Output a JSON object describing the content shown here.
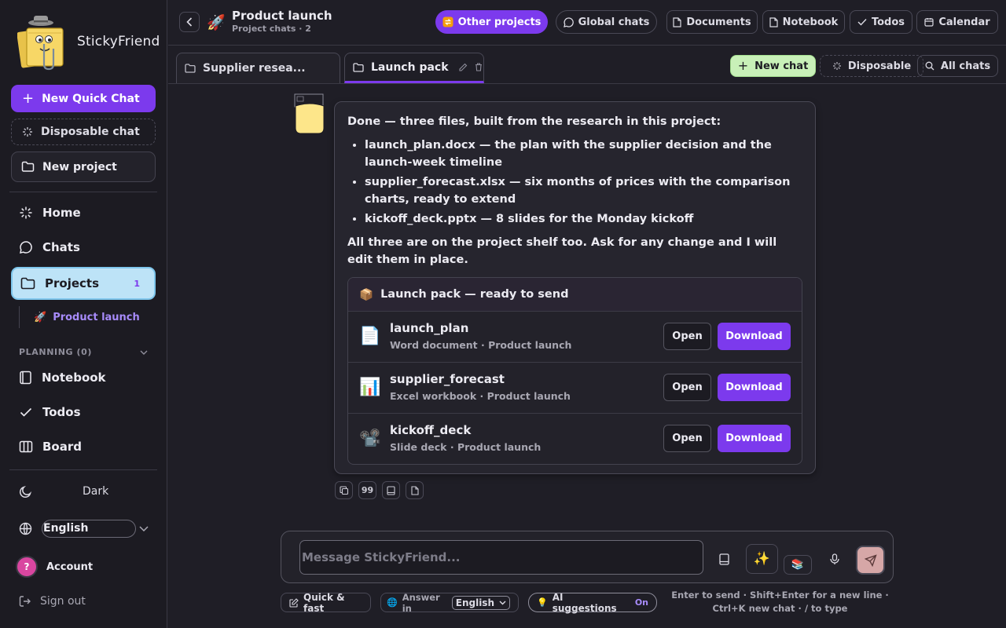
{
  "app": {
    "name": "StickyFriend"
  },
  "sidebar": {
    "new_quick_chat": "New Quick Chat",
    "disposable_chat": "Disposable chat",
    "new_project": "New project",
    "nav": {
      "home": "Home",
      "chats": "Chats",
      "projects": "Projects",
      "projects_badge": "1",
      "notebook": "Notebook",
      "todos": "Todos",
      "board": "Board"
    },
    "active_project": {
      "emoji": "🚀",
      "name": "Product launch"
    },
    "planning_label": "PLANNING (0)",
    "theme": "Dark",
    "language": "English",
    "account": {
      "initial": "?",
      "label": "Account"
    },
    "sign_out": "Sign out"
  },
  "header": {
    "project_emoji": "🚀",
    "project_title": "Product launch",
    "project_subtitle": "Project chats · 2",
    "buttons": {
      "other_projects": "Other projects",
      "global_chats": "Global chats",
      "documents": "Documents",
      "notebook": "Notebook",
      "todos": "Todos",
      "calendar": "Calendar"
    }
  },
  "tabs": {
    "items": [
      {
        "label": "Supplier resea..."
      },
      {
        "label": "Launch pack"
      }
    ],
    "new_chat": "New chat",
    "disposable": "Disposable",
    "all_chats": "All chats"
  },
  "message": {
    "intro": "Done — three files, built from the research in this project:",
    "bullets": [
      "launch_plan.docx — the plan with the supplier decision and the launch-week timeline",
      "supplier_forecast.xlsx — six months of prices with the comparison charts, ready to extend",
      "kickoff_deck.pptx — 8 slides for the Monday kickoff"
    ],
    "outro": "All three are on the project shelf too. Ask for any change and I will edit them in place.",
    "card": {
      "emoji": "📦",
      "title": "Launch pack — ready to send",
      "files": [
        {
          "icon": "📄",
          "name": "launch_plan",
          "meta": "Word document · Product launch",
          "open": "Open",
          "download": "Download"
        },
        {
          "icon": "📊",
          "name": "supplier_forecast",
          "meta": "Excel workbook · Product launch",
          "open": "Open",
          "download": "Download"
        },
        {
          "icon": "📽️",
          "name": "kickoff_deck",
          "meta": "Slide deck · Product launch",
          "open": "Open",
          "download": "Download"
        }
      ]
    },
    "tools": {
      "quote": "99"
    }
  },
  "composer": {
    "placeholder": "Message StickyFriend...",
    "sparkle": "✨",
    "books": "📚",
    "quick_fast": "Quick & fast",
    "answer_in_label": "Answer in",
    "answer_language": "English",
    "ai_suggestions_emoji": "💡",
    "ai_suggestions": "AI suggestions",
    "ai_suggestions_state": "On",
    "hint_line1": "Enter to send · Shift+Enter for a new line ·",
    "hint_line2": "Ctrl+K new chat · / to type"
  },
  "colors": {
    "accent": "#7c3aed",
    "background": "#1f1e26",
    "sidebar": "#1c1b22",
    "active_nav": "#bde3f7",
    "new_chat": "#c8f0b8"
  }
}
